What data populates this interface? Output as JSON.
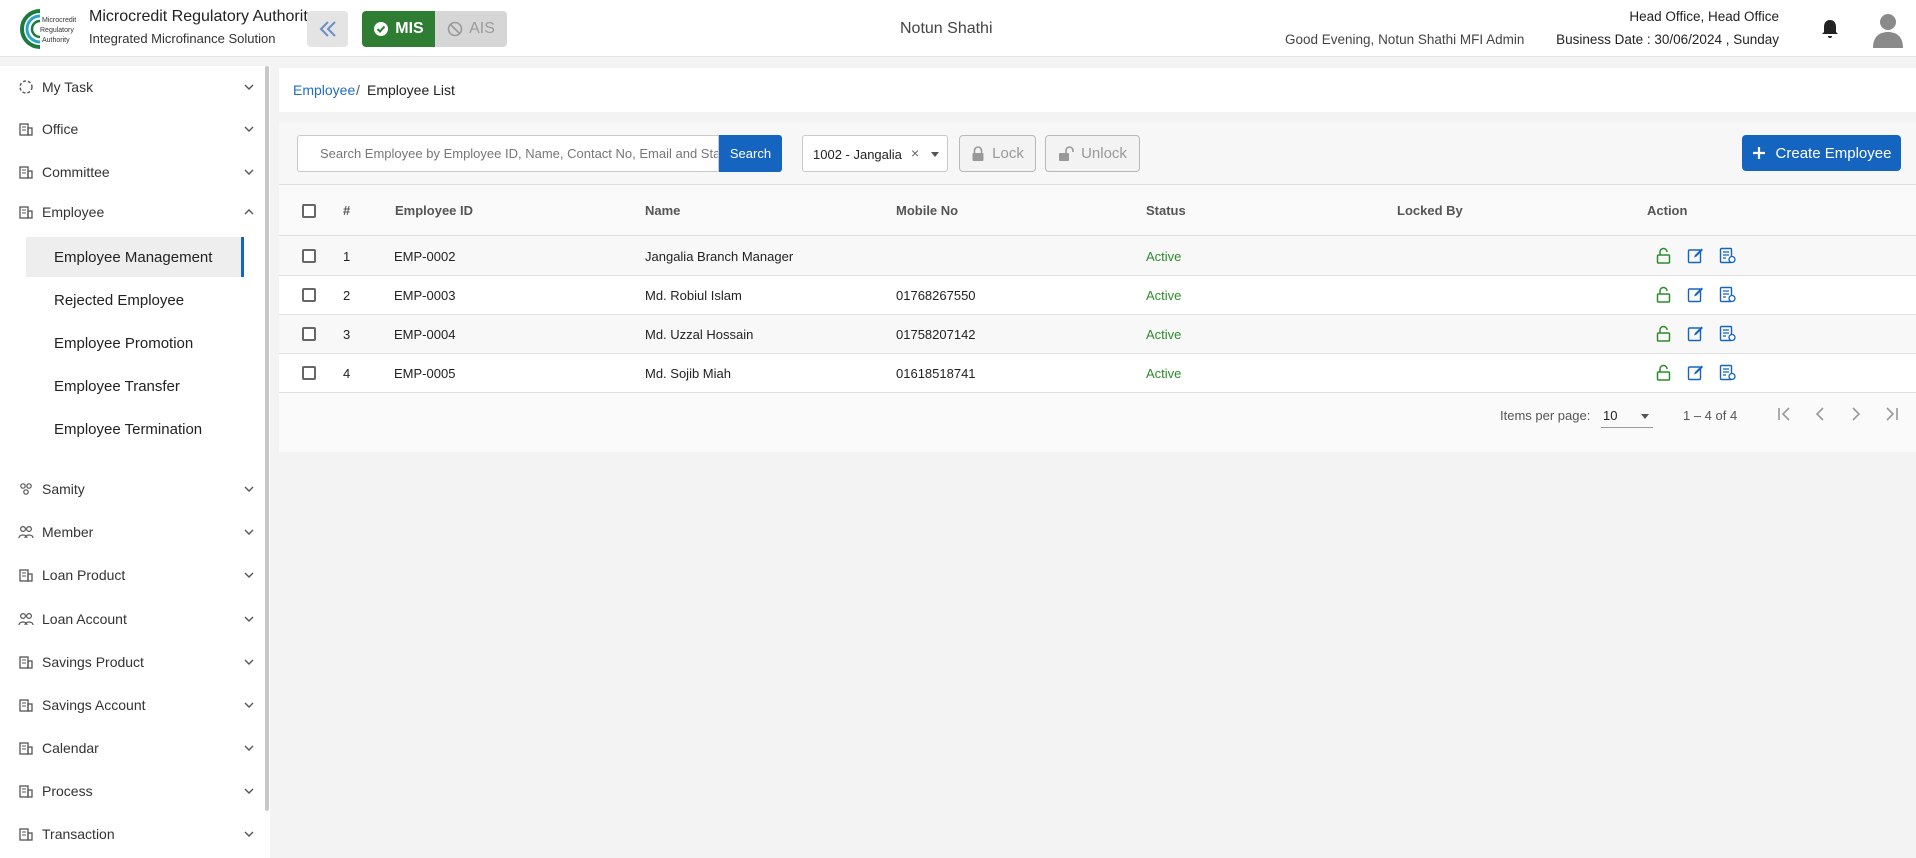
{
  "header": {
    "org_name": "Microcredit Regulatory Authority",
    "org_subtitle": "Integrated Microfinance Solution",
    "logo_text": "Microcredit Regulatory Authority",
    "mode_mis": "MIS",
    "mode_ais": "AIS",
    "center_title": "Notun Shathi",
    "greeting": "Good Evening, Notun Shathi MFI Admin",
    "office": "Head Office, Head Office",
    "business_date": "Business Date : 30/06/2024 , Sunday"
  },
  "sidebar": {
    "items": [
      {
        "label": "My Task",
        "icon": "clock-icon"
      },
      {
        "label": "Office",
        "icon": "office-icon"
      },
      {
        "label": "Committee",
        "icon": "office-icon"
      },
      {
        "label": "Employee",
        "icon": "office-icon"
      }
    ],
    "employee_sub": [
      {
        "label": "Employee Management",
        "active": true
      },
      {
        "label": "Rejected Employee"
      },
      {
        "label": "Employee Promotion"
      },
      {
        "label": "Employee Transfer"
      },
      {
        "label": "Employee Termination"
      }
    ],
    "items_after": [
      {
        "label": "Samity",
        "icon": "group-icon"
      },
      {
        "label": "Member",
        "icon": "users-icon"
      },
      {
        "label": "Loan Product",
        "icon": "office-icon"
      },
      {
        "label": "Loan Account",
        "icon": "users-icon"
      },
      {
        "label": "Savings Product",
        "icon": "office-icon"
      },
      {
        "label": "Savings Account",
        "icon": "office-icon"
      },
      {
        "label": "Calendar",
        "icon": "office-icon"
      },
      {
        "label": "Process",
        "icon": "office-icon"
      },
      {
        "label": "Transaction",
        "icon": "office-icon"
      }
    ]
  },
  "breadcrumb": {
    "link": "Employee",
    "separator": "/",
    "current": "Employee List"
  },
  "toolbar": {
    "search_placeholder": "Search Employee by Employee ID, Name, Contact No, Email and Status",
    "search_label": "Search",
    "branch_value": "1002 - Jangalia",
    "clear_symbol": "×",
    "lock_label": "Lock",
    "unlock_label": "Unlock",
    "create_label": "Create Employee"
  },
  "table": {
    "columns": [
      "#",
      "Employee ID",
      "Name",
      "Mobile No",
      "Status",
      "Locked By",
      "Action"
    ],
    "rows": [
      {
        "no": "1",
        "id": "EMP-0002",
        "name": "Jangalia Branch Manager",
        "mobile": "",
        "status": "Active",
        "locked_by": ""
      },
      {
        "no": "2",
        "id": "EMP-0003",
        "name": "Md. Robiul Islam",
        "mobile": "01768267550",
        "status": "Active",
        "locked_by": ""
      },
      {
        "no": "3",
        "id": "EMP-0004",
        "name": "Md. Uzzal Hossain",
        "mobile": "01758207142",
        "status": "Active",
        "locked_by": ""
      },
      {
        "no": "4",
        "id": "EMP-0005",
        "name": "Md. Sojib Miah",
        "mobile": "01618518741",
        "status": "Active",
        "locked_by": ""
      }
    ]
  },
  "pagination": {
    "label": "Items per page:",
    "per_page": "10",
    "range": "1 – 4 of 4"
  },
  "colors": {
    "primary": "#1565c0",
    "success": "#2e7d32",
    "active_status": "#2e8b2e"
  }
}
